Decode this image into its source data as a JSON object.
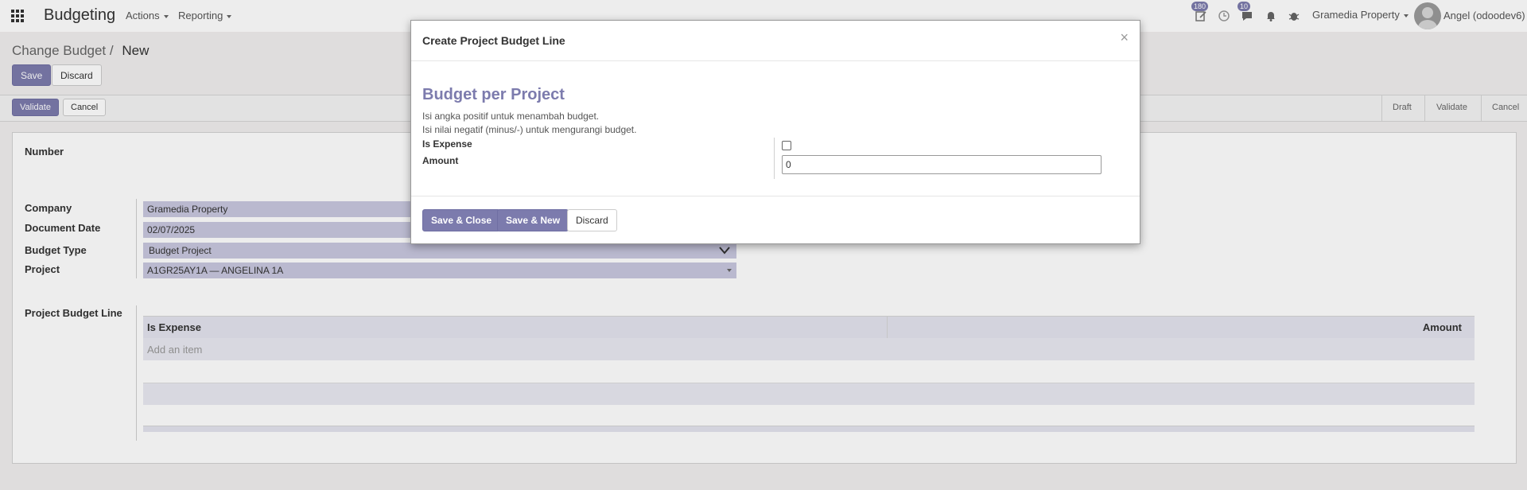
{
  "topbar": {
    "app_title": "Budgeting",
    "menu": [
      {
        "label": "Actions"
      },
      {
        "label": "Reporting"
      }
    ],
    "activity_badge": "180",
    "messages_badge": "10",
    "company": "Gramedia Property",
    "user": "Angel (odoodev6)"
  },
  "breadcrumb": {
    "parent": "Change Budget",
    "separator": "/",
    "current": "New"
  },
  "control": {
    "save_label": "Save",
    "discard_label": "Discard"
  },
  "statusbar": {
    "validate_label": "Validate",
    "cancel_label": "Cancel",
    "stages": [
      "Draft",
      "Validate",
      "Cancel"
    ]
  },
  "form": {
    "number_label": "Number",
    "company_label": "Company",
    "company_value": "Gramedia Property",
    "date_label": "Document Date",
    "date_value": "02/07/2025",
    "budget_type_label": "Budget Type",
    "budget_type_value": "Budget Project",
    "project_label": "Project",
    "project_value": "A1GR25AY1A — ANGELINA 1A",
    "lines_label": "Project Budget Line",
    "col_is_expense": "Is Expense",
    "col_amount": "Amount",
    "add_item": "Add an item"
  },
  "modal": {
    "title": "Create Project Budget Line",
    "close_glyph": "×",
    "heading": "Budget per Project",
    "help_line_1": "Isi angka positif untuk menambah budget.",
    "help_line_2": "Isi nilai negatif (minus/-) untuk mengurangi budget.",
    "is_expense_label": "Is Expense",
    "is_expense_checked": false,
    "amount_label": "Amount",
    "amount_value": "0",
    "save_close_label": "Save & Close",
    "save_new_label": "Save & New",
    "discard_label": "Discard"
  },
  "colors": {
    "primary": "#7c7bad",
    "field_bg": "#c9c8df"
  }
}
